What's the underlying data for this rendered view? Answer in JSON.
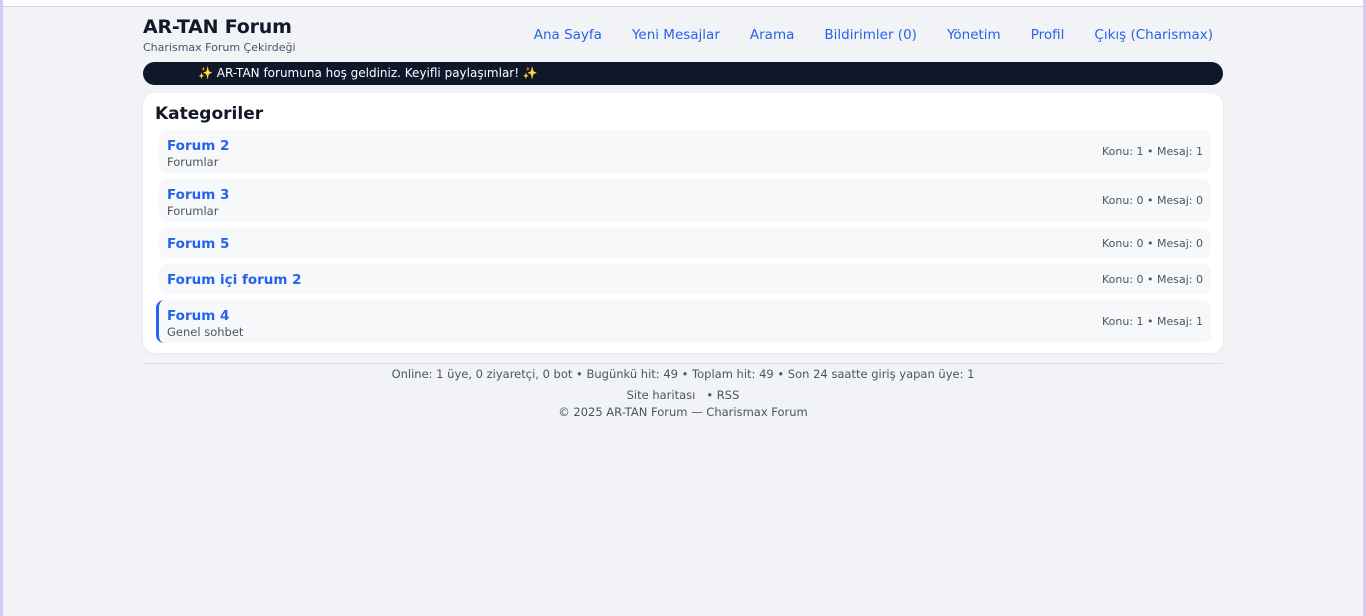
{
  "header": {
    "title": "AR-TAN Forum",
    "subtitle": "Charismax Forum Çekirdeği",
    "nav": [
      "Ana Sayfa",
      "Yeni Mesajlar",
      "Arama",
      "Bildirimler (0)",
      "Yönetim",
      "Profil",
      "Çıkış (Charismax)"
    ]
  },
  "banner": {
    "text": "✨ AR-TAN forumuna hoş geldiniz. Keyifli paylaşımlar! ✨"
  },
  "categories": {
    "title": "Kategoriler",
    "items": [
      {
        "name": "Forum 2",
        "desc": "Forumlar",
        "stats": "Konu: 1 • Mesaj: 1"
      },
      {
        "name": "Forum 3",
        "desc": "Forumlar",
        "stats": "Konu: 0 • Mesaj: 0"
      },
      {
        "name": "Forum 5",
        "desc": "",
        "stats": "Konu: 0 • Mesaj: 0"
      },
      {
        "name": "Forum içi forum 2",
        "desc": "",
        "stats": "Konu: 0 • Mesaj: 0"
      },
      {
        "name": "Forum 4",
        "desc": "Genel sohbet",
        "stats": "Konu: 1 • Mesaj: 1"
      }
    ]
  },
  "footer": {
    "stats": "Online: 1 üye, 0 ziyaretçi, 0 bot • Bugünkü hit: 49 • Toplam hit: 49 • Son 24 saatte giriş yapan üye: 1",
    "sitemap": "Site haritası",
    "separator": "•",
    "rss": "RSS",
    "copyright": "© 2025 AR-TAN Forum — Charismax Forum"
  },
  "colors": {
    "accent": "#2563eb",
    "banner_bg": "#0f172a",
    "page_bg": "#f1f3f6"
  }
}
